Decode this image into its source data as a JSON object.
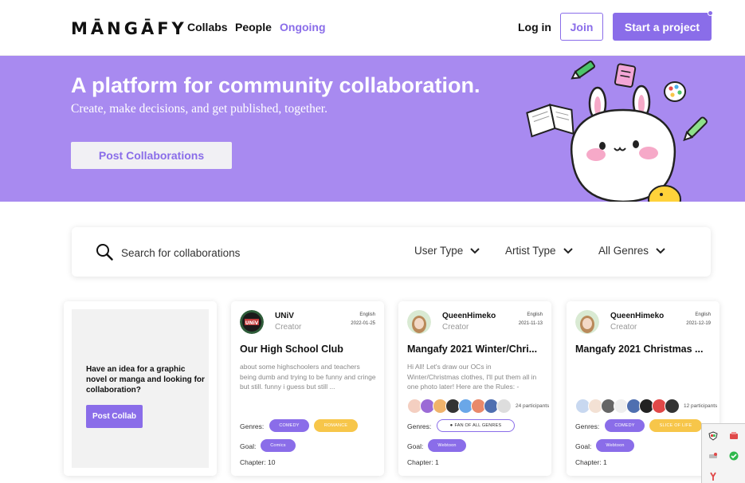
{
  "nav": {
    "logo": "MĀNGĀFY",
    "links": [
      "Collabs",
      "People",
      "Ongoing"
    ],
    "login": "Log in",
    "join": "Join",
    "start": "Start a project"
  },
  "hero": {
    "title": "A platform for community collaboration.",
    "subtitle": "Create, make decisions, and get published, together.",
    "button": "Post Collaborations"
  },
  "search": {
    "placeholder": "Search for collaborations",
    "filters": [
      "User Type",
      "Artist Type",
      "All Genres"
    ]
  },
  "idea_card": {
    "text": "Have an idea for a graphic novel or manga and looking for collaboration?",
    "button": "Post Collab"
  },
  "cards": [
    {
      "user": "UNiV",
      "role": "Creator",
      "language": "English",
      "date": "2022-01-25",
      "title": "Our High School Club",
      "description": "about some highschoolers and teachers being dumb and trying to be funny and cringe but still. funny i guess but still ...",
      "participants": "",
      "genres_label": "Genres:",
      "genres": [
        "COMEDY",
        "ROMANCE"
      ],
      "goal_label": "Goal:",
      "goal": "Comics",
      "chapter_label": "Chapter:",
      "chapter": "10"
    },
    {
      "user": "QueenHimeko",
      "role": "Creator",
      "language": "English",
      "date": "2021-11-13",
      "title": "Mangafy 2021 Winter/Chri...",
      "description": "Hi All! Let's draw our OCs in Winter/Christmas clothes, I'll put them all in one photo later! Here are the Rules: -Limited...",
      "participants": "24 participants",
      "genres_label": "Genres:",
      "genres": [
        "FAN OF ALL GENRES"
      ],
      "goal_label": "Goal:",
      "goal": "Webtoon",
      "chapter_label": "Chapter:",
      "chapter": "1"
    },
    {
      "user": "QueenHimeko",
      "role": "Creator",
      "language": "English",
      "date": "2021-12-19",
      "title": "Mangafy 2021 Christmas ...",
      "description": "",
      "participants": "12 participants",
      "genres_label": "Genres:",
      "genres": [
        "COMEDY",
        "SLICE OF LIFE"
      ],
      "goal_label": "Goal:",
      "goal": "Webtoon",
      "chapter_label": "Chapter:",
      "chapter": "1"
    }
  ],
  "colors": {
    "accent": "#8a6de9",
    "hero_bg": "#a88af0",
    "badge_yellow": "#f7c64a"
  }
}
